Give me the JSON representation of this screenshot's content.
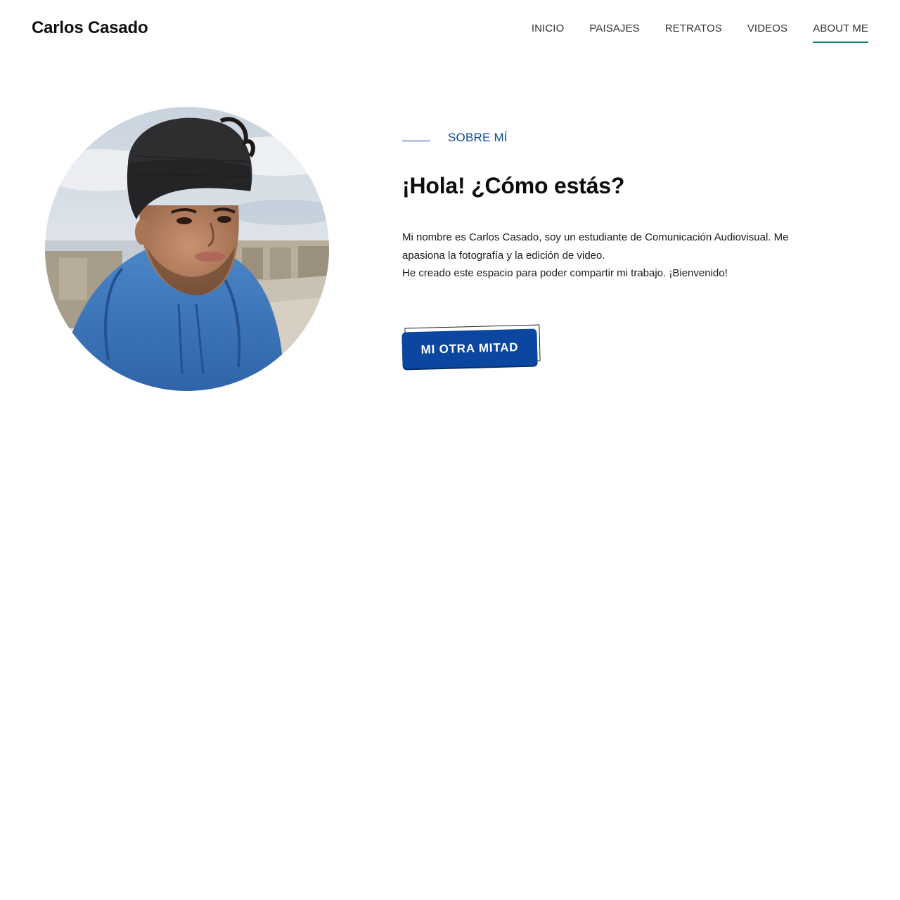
{
  "header": {
    "site_title": "Carlos Casado",
    "nav": [
      {
        "label": "INICIO"
      },
      {
        "label": "PAISAJES"
      },
      {
        "label": "RETRATOS"
      },
      {
        "label": "VIDEOS"
      },
      {
        "label": "ABOUT ME",
        "active": true
      }
    ]
  },
  "about": {
    "kicker": "SOBRE MÍ",
    "heading": "¡Hola! ¿Cómo estás?",
    "bio_line1": "Mi nombre es Carlos Casado, soy un estudiante de Comunicación Audiovisual. Me apasiona la fotografía y la edición de video.",
    "bio_line2": "He creado este espacio para poder compartir mi trabajo. ¡Bienvenido!",
    "cta_label": "MI OTRA MITAD"
  },
  "colors": {
    "accent_blue": "#0b46a0",
    "nav_underline": "#1a8a7a"
  }
}
